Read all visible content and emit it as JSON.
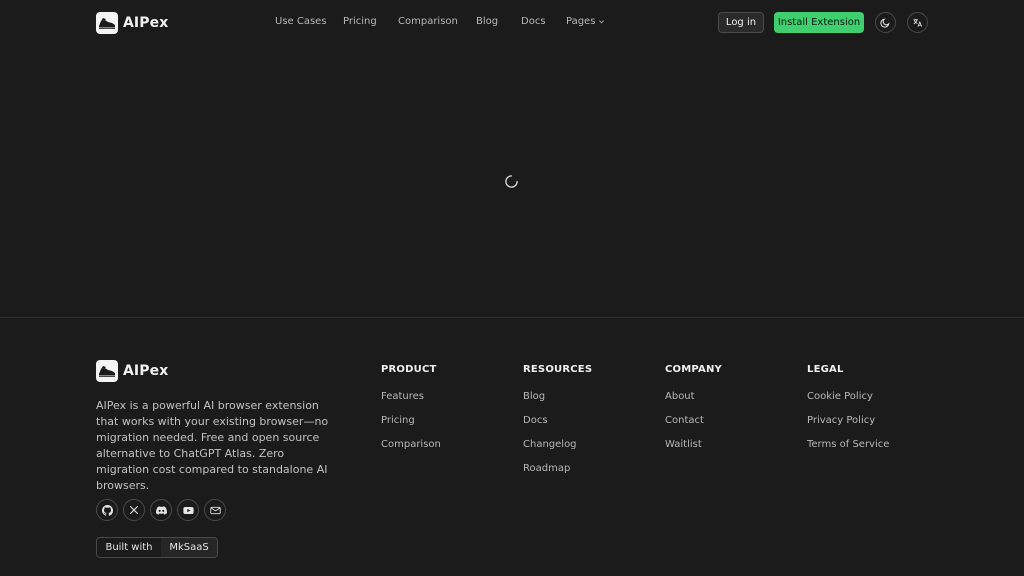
{
  "brand": {
    "name": "AIPex",
    "logo_icon": "shoe-logo-icon"
  },
  "nav": {
    "items": [
      "Use Cases",
      "Pricing",
      "Comparison",
      "Blog",
      "Docs"
    ],
    "pages_label": "Pages"
  },
  "header": {
    "login_label": "Log in",
    "install_label": "Install Extension",
    "theme_icon": "moon-icon",
    "language_icon": "translate-icon"
  },
  "main": {
    "loading_icon": "loading-spinner-icon"
  },
  "footer": {
    "description": "AIPex is a powerful AI browser extension that works with your existing browser—no migration needed. Free and open source alternative to ChatGPT Atlas. Zero migration cost compared to standalone AI browsers.",
    "socials": [
      "github-icon",
      "x-icon",
      "discord-icon",
      "youtube-icon",
      "mail-icon"
    ],
    "built_with": {
      "label": "Built with",
      "name": "MkSaaS"
    },
    "columns": [
      {
        "title": "PRODUCT",
        "links": [
          "Features",
          "Pricing",
          "Comparison"
        ]
      },
      {
        "title": "RESOURCES",
        "links": [
          "Blog",
          "Docs",
          "Changelog",
          "Roadmap"
        ]
      },
      {
        "title": "COMPANY",
        "links": [
          "About",
          "Contact",
          "Waitlist"
        ]
      },
      {
        "title": "LEGAL",
        "links": [
          "Cookie Policy",
          "Privacy Policy",
          "Terms of Service"
        ]
      }
    ]
  },
  "colors": {
    "background": "#1b1b1c",
    "accent": "#3fcf6e",
    "muted_text": "#b8b8b8"
  }
}
